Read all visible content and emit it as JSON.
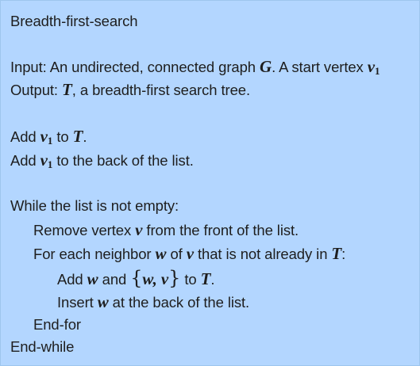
{
  "algorithm": {
    "title": "Breadth-first-search",
    "input": {
      "prefix": "Input: An undirected, connected graph ",
      "graph_var": "G",
      "middle": ". A start vertex ",
      "start_var": "v",
      "start_sub": "1"
    },
    "output": {
      "prefix": "Output: ",
      "tree_var": "T",
      "suffix": ", a breadth-first search tree."
    },
    "step_add_v1": {
      "prefix": "Add ",
      "var": "v",
      "sub": "1",
      "middle": " to ",
      "tree_var": "T",
      "suffix": "."
    },
    "step_add_v1_list": {
      "prefix": "Add ",
      "var": "v",
      "sub": "1",
      "suffix": " to the back of the list."
    },
    "while_header": "While the list is not empty:",
    "remove_step": {
      "prefix": "Remove vertex ",
      "var": "v",
      "suffix": " from the front of the list."
    },
    "for_header": {
      "prefix": "For each neighbor ",
      "w_var": "w",
      "middle": " of ",
      "v_var": "v",
      "middle2": " that is not already in ",
      "tree_var": "T",
      "suffix": ":"
    },
    "add_edge_step": {
      "prefix": "Add ",
      "w_var": "w",
      "middle": " and ",
      "open_brace": "{",
      "edge_w": "w",
      "comma": ", ",
      "edge_v": "v",
      "close_brace": "}",
      "middle2": " to ",
      "tree_var": "T",
      "suffix": "."
    },
    "insert_step": {
      "prefix": "Insert ",
      "w_var": "w",
      "suffix": " at the back of the list."
    },
    "end_for": "End-for",
    "end_while": "End-while"
  },
  "colors": {
    "background": "#b3d6ff",
    "text": "#1e1e1e"
  }
}
